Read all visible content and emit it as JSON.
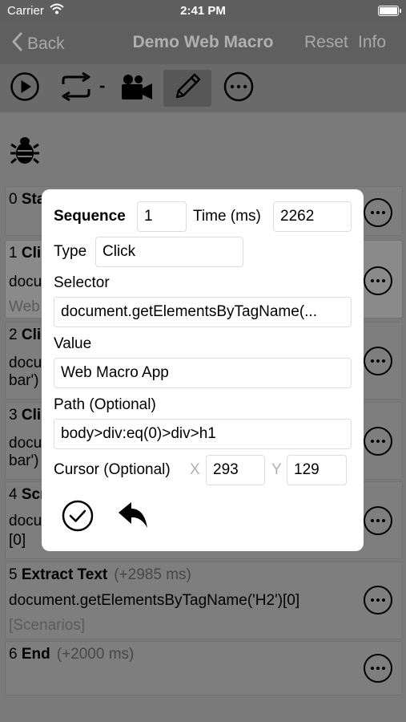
{
  "status_bar": {
    "carrier": "Carrier",
    "time": "2:41 PM"
  },
  "nav": {
    "back_label": "Back",
    "title": "Demo Web Macro",
    "reset_label": "Reset",
    "info_label": "Info"
  },
  "toolbar": {
    "separator": "-"
  },
  "steps": [
    {
      "index": "0",
      "name": "Start",
      "delta": "",
      "line2": "",
      "line3": ""
    },
    {
      "index": "1",
      "name": "Click",
      "delta": "",
      "line2": "document",
      "line3": "Web Macro App"
    },
    {
      "index": "2",
      "name": "Click",
      "delta": "",
      "line2": "document",
      "line3": "bar')"
    },
    {
      "index": "3",
      "name": "Click",
      "delta": "",
      "line2": "document",
      "line3": "bar')"
    },
    {
      "index": "4",
      "name": "Scroll",
      "delta": "",
      "line2": "document",
      "line3": "[0]"
    },
    {
      "index": "5",
      "name": "Extract Text",
      "delta": "(+2985 ms)",
      "line2": "document.getElementsByTagName('H2')[0]",
      "line3": "[Scenarios]"
    },
    {
      "index": "6",
      "name": "End",
      "delta": "(+2000 ms)",
      "line2": "",
      "line3": ""
    }
  ],
  "dialog": {
    "sequence_label": "Sequence",
    "sequence_value": "1",
    "time_label": "Time (ms)",
    "time_value": "2262",
    "type_label": "Type",
    "type_value": "Click",
    "selector_label": "Selector",
    "selector_value": "document.getElementsByTagName(...",
    "value_label": "Value",
    "value_value": "Web Macro App",
    "path_label": "Path (Optional)",
    "path_value": "body>div:eq(0)>div>h1",
    "cursor_label": "Cursor (Optional)",
    "x_label": "X",
    "x_value": "293",
    "y_label": "Y",
    "y_value": "129"
  }
}
